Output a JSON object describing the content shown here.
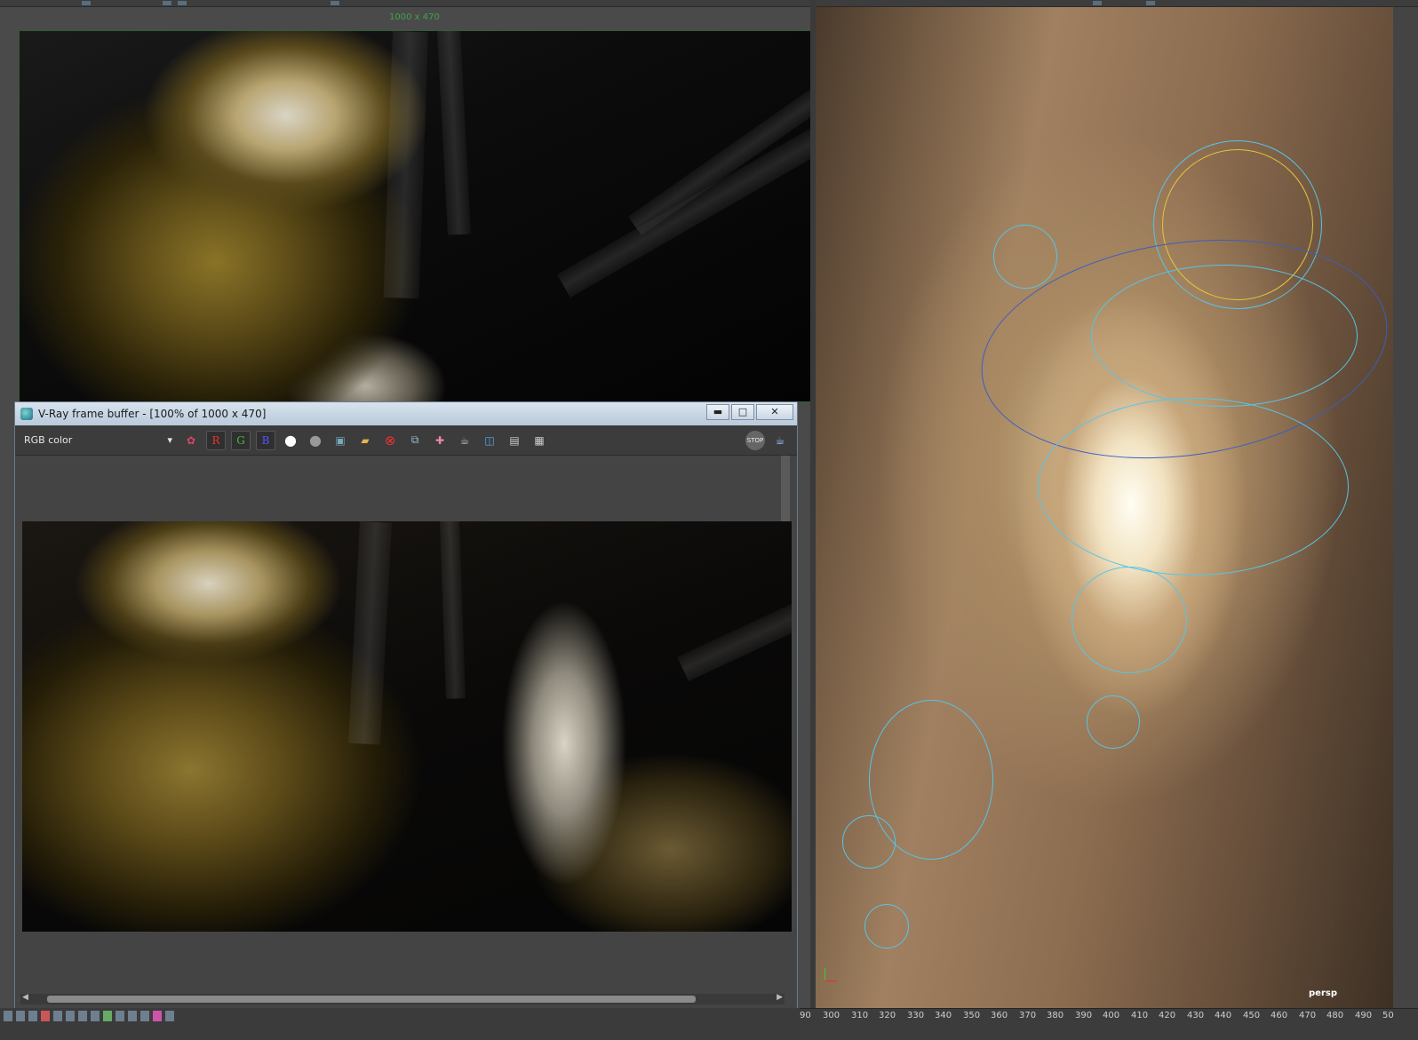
{
  "render_view": {
    "resolution_label": "1000 x 470"
  },
  "frame_buffer": {
    "title": "V-Ray frame buffer - [100% of 1000 x 470]",
    "window_buttons": {
      "minimize": "▬",
      "maximize": "□",
      "close": "✕"
    },
    "channel": "RGB color",
    "channel_buttons": [
      "R",
      "G",
      "B"
    ],
    "icons": [
      "color-wheel-icon",
      "white-circle-icon",
      "gray-circle-icon",
      "save-icon",
      "open-folder-icon",
      "clear-icon",
      "region-icon",
      "track-mouse-icon",
      "teapot-icon",
      "compare-icon",
      "history-icon",
      "lut-icon",
      "stop-icon",
      "render-teapot-icon"
    ],
    "stop_label": "STOP"
  },
  "viewport": {
    "camera_label": "persp"
  },
  "time_slider": {
    "ticks": [
      "90",
      "300",
      "310",
      "320",
      "330",
      "340",
      "350",
      "360",
      "370",
      "380",
      "390",
      "400",
      "410",
      "420",
      "430",
      "440",
      "450",
      "460",
      "470",
      "480",
      "490",
      "50"
    ]
  },
  "colors": {
    "render_border": "#2f5d33",
    "manipulator": "#57c4e8",
    "resolution_label": "#3fa34d"
  }
}
